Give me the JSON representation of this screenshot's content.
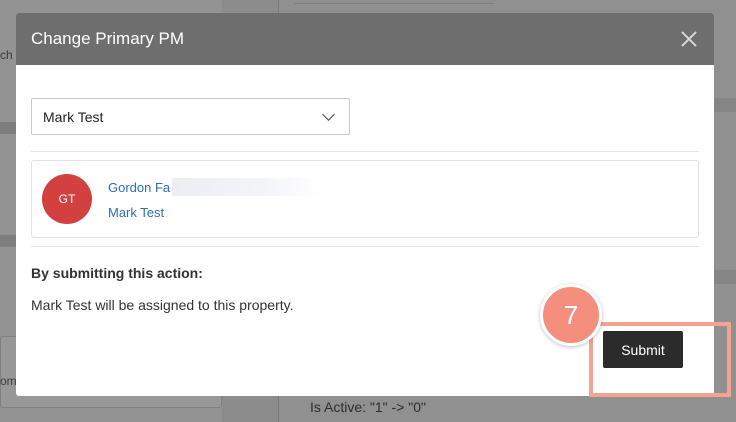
{
  "background": {
    "left_fragment_1": "ch",
    "left_fragment_2": "om",
    "is_active_change": "Is Active: \"1\" -> \"0\""
  },
  "modal": {
    "title": "Change Primary PM",
    "close_icon": "close-icon",
    "pm_select": {
      "selected": "Mark Test"
    },
    "pm_card": {
      "avatar_initials": "GT",
      "current_pm": "Gordon Fa",
      "new_pm": "Mark Test"
    },
    "confirmation": {
      "heading": "By submitting this action:",
      "text": "Mark Test will be assigned to this property."
    },
    "submit_label": "Submit"
  },
  "annotation": {
    "step_number": "7"
  },
  "colors": {
    "header": "#6e6e6e",
    "avatar": "#d24040",
    "link": "#2f6db4",
    "submit": "#2b2b2b",
    "step_accent": "#f58f7d"
  }
}
